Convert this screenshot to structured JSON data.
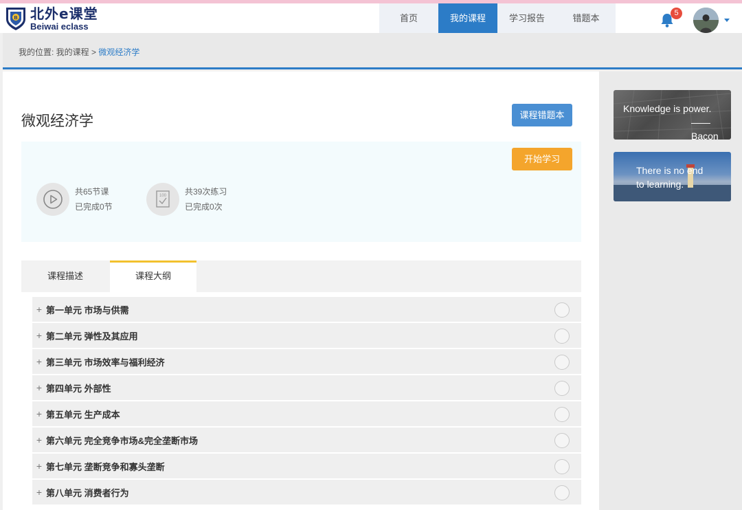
{
  "header": {
    "logo_cn": "北外e课堂",
    "logo_en": "Beiwai eclass",
    "nav": [
      {
        "label": "首页",
        "active": false
      },
      {
        "label": "我的课程",
        "active": true
      },
      {
        "label": "学习报告",
        "active": false
      },
      {
        "label": "错题本",
        "active": false
      }
    ],
    "notification_count": "5"
  },
  "breadcrumb": {
    "prefix": "我的位置: 我的课程 > ",
    "current": "微观经济学"
  },
  "course": {
    "title": "微观经济学",
    "wrong_book_button": "课程错题本",
    "start_button": "开始学习",
    "lessons_total": "共65节课",
    "lessons_done": "已完成0节",
    "exercises_total": "共39次练习",
    "exercises_done": "已完成0次"
  },
  "tabs": [
    {
      "label": "课程描述",
      "active": false
    },
    {
      "label": "课程大纲",
      "active": true
    }
  ],
  "units": [
    "第一单元 市场与供需",
    "第二单元 弹性及其应用",
    "第三单元 市场效率与福利经济",
    "第四单元 外部性",
    "第五单元 生产成本",
    "第六单元 完全竞争市场&完全垄断市场",
    "第七单元 垄断竞争和寡头垄断",
    "第八单元 消费者行为"
  ],
  "sidebar": {
    "banner1_line1": "Knowledge is power.",
    "banner1_line2": "——Bacon",
    "banner2_line1": "There is no end",
    "banner2_line2": "to learning."
  },
  "colors": {
    "primary": "#2c7cc7",
    "accent_orange": "#f4a52c",
    "tab_underline": "#f2c12e"
  }
}
